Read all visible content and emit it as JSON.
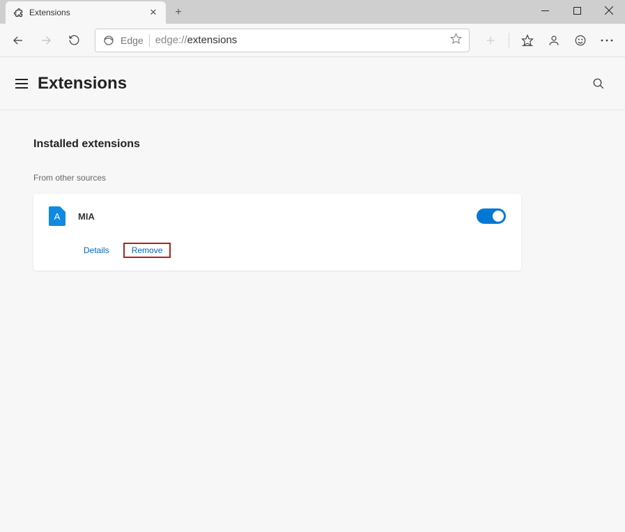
{
  "tab": {
    "title": "Extensions"
  },
  "addressbar": {
    "label": "Edge",
    "url_prefix": "edge://",
    "url_path": "extensions"
  },
  "page": {
    "title": "Extensions"
  },
  "section": {
    "installed_title": "Installed extensions",
    "from_other_label": "From other sources"
  },
  "extension": {
    "name": "MIA",
    "icon_letter": "A",
    "details_label": "Details",
    "remove_label": "Remove"
  }
}
